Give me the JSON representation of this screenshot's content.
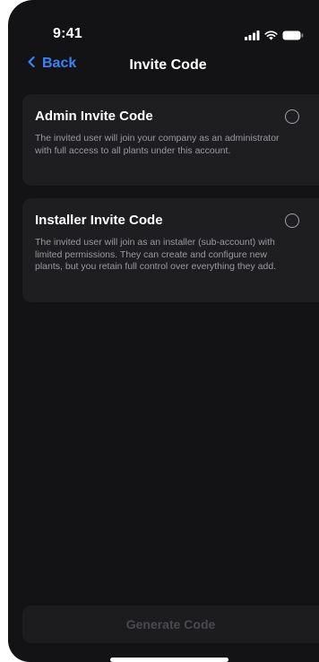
{
  "status_bar": {
    "time": "9:41",
    "icons": [
      "signal-icon",
      "wifi-icon",
      "battery-icon"
    ]
  },
  "nav": {
    "back_label": "Back",
    "title": "Invite Code"
  },
  "options": [
    {
      "title": "Admin Invite Code",
      "description": "The invited user will join your company as an administrator with full access to all plants under this account.",
      "selected": false
    },
    {
      "title": "Installer Invite Code",
      "description": "The invited user will join as an installer (sub-account) with limited permissions. They can create and configure new plants, but you retain full control over everything they add.",
      "selected": false
    }
  ],
  "footer": {
    "generate_label": "Generate Code",
    "enabled": false
  },
  "colors": {
    "background": "#131315",
    "card": "#1e1e20",
    "accent": "#3b82f6",
    "secondary_text": "#9a9aa0",
    "disabled_text": "#4a4a4e"
  }
}
